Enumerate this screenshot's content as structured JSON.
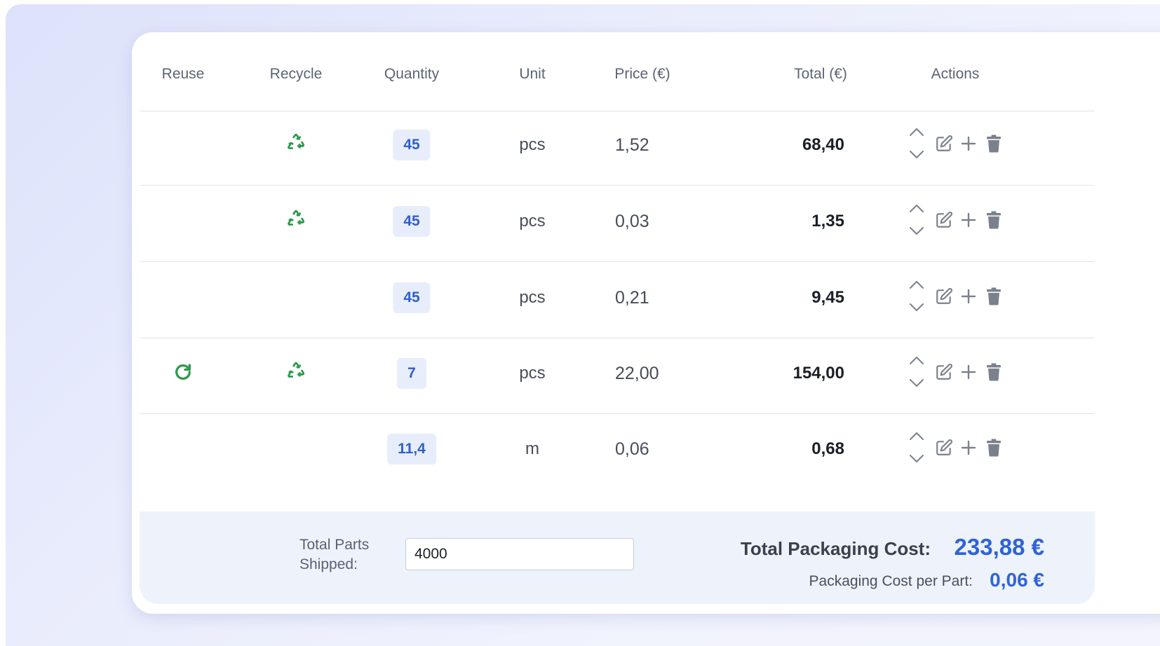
{
  "table": {
    "headers": {
      "reuse": "Reuse",
      "recycle": "Recycle",
      "quantity": "Quantity",
      "unit": "Unit",
      "price": "Price (€)",
      "total": "Total (€)",
      "actions": "Actions"
    },
    "rows": [
      {
        "reuse": false,
        "recycle": true,
        "quantity": "45",
        "unit": "pcs",
        "price": "1,52",
        "total": "68,40"
      },
      {
        "reuse": false,
        "recycle": true,
        "quantity": "45",
        "unit": "pcs",
        "price": "0,03",
        "total": "1,35"
      },
      {
        "reuse": false,
        "recycle": false,
        "quantity": "45",
        "unit": "pcs",
        "price": "0,21",
        "total": "9,45"
      },
      {
        "reuse": true,
        "recycle": true,
        "quantity": "7",
        "unit": "pcs",
        "price": "22,00",
        "total": "154,00"
      },
      {
        "reuse": false,
        "recycle": false,
        "quantity": "11,4",
        "unit": "m",
        "price": "0,06",
        "total": "0,68"
      }
    ]
  },
  "footer": {
    "parts_label": "Total Parts Shipped:",
    "parts_value": "4000",
    "total_cost_label": "Total Packaging Cost:",
    "total_cost_value": "233,88 €",
    "cost_per_part_label": "Packaging Cost per Part:",
    "cost_per_part_value": "0,06 €"
  },
  "icons": {
    "reuse": "refresh-icon",
    "recycle": "recycle-icon",
    "move_up": "chevron-up-icon",
    "move_down": "chevron-down-icon",
    "edit": "edit-icon",
    "add": "plus-icon",
    "delete": "trash-icon"
  },
  "colors": {
    "accent": "#2f63d6",
    "eco_green": "#2e9a4c",
    "quantity_badge_bg": "#e7edfb",
    "footer_bg": "#eef2fb"
  }
}
